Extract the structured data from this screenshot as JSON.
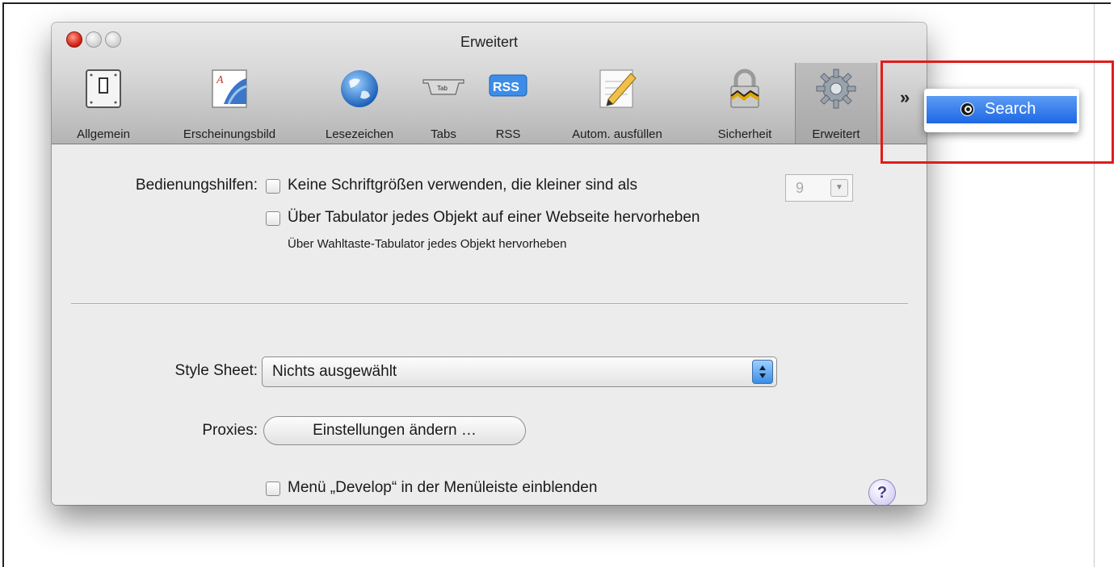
{
  "window": {
    "title": "Erweitert"
  },
  "toolbar": {
    "items": [
      {
        "label": "Allgemein",
        "icon": "switch-icon"
      },
      {
        "label": "Erscheinungsbild",
        "icon": "appearance-icon"
      },
      {
        "label": "Lesezeichen",
        "icon": "globe-icon"
      },
      {
        "label": "Tabs",
        "icon": "tab-icon",
        "icon_text": "Tab"
      },
      {
        "label": "RSS",
        "icon": "rss-icon",
        "icon_text": "RSS"
      },
      {
        "label": "Autom. ausfüllen",
        "icon": "pencil-icon"
      },
      {
        "label": "Sicherheit",
        "icon": "lock-icon"
      },
      {
        "label": "Erweitert",
        "icon": "gear-icon"
      }
    ],
    "overflow_label": "»",
    "search_menu_item": "Search"
  },
  "accessibility": {
    "label": "Bedienungshilfen:",
    "min_font_option": "Keine Schriftgrößen verwenden, die kleiner sind als",
    "min_font_value": "9",
    "tab_highlight_option": "Über Tabulator jedes Objekt auf einer Webseite hervorheben",
    "tab_highlight_note": "Über Wahltaste-Tabulator jedes Objekt hervorheben"
  },
  "style_sheet": {
    "label": "Style Sheet:",
    "value": "Nichts ausgewählt"
  },
  "proxies": {
    "label": "Proxies:",
    "button_label": "Einstellungen ändern …"
  },
  "develop": {
    "option": "Menü „Develop“ in der Menüleiste einblenden"
  },
  "help": {
    "label": "?"
  },
  "colors": {
    "accent": "#1d67e4",
    "highlight_box": "#e21b1b"
  }
}
